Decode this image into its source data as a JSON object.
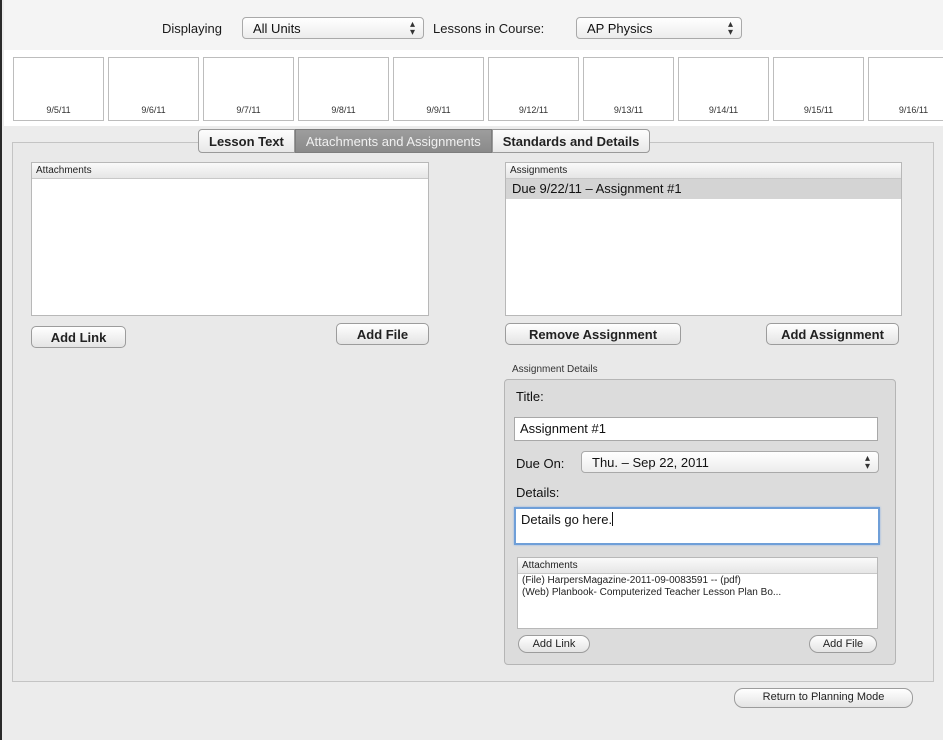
{
  "toolbar": {
    "displaying_label": "Displaying",
    "displaying_value": "All Units",
    "course_label": "Lessons in Course:",
    "course_value": "AP Physics"
  },
  "dates": [
    "9/5/11",
    "9/6/11",
    "9/7/11",
    "9/8/11",
    "9/9/11",
    "9/12/11",
    "9/13/11",
    "9/14/11",
    "9/15/11",
    "9/16/11"
  ],
  "tabs": [
    {
      "label": "Lesson Text",
      "active": false
    },
    {
      "label": "Attachments and Assignments",
      "active": true
    },
    {
      "label": "Standards and Details",
      "active": false
    }
  ],
  "attachments": {
    "header": "Attachments",
    "add_link": "Add Link",
    "add_file": "Add File"
  },
  "assignments": {
    "header": "Assignments",
    "items": [
      "Due 9/22/11 – Assignment #1"
    ],
    "remove_button": "Remove Assignment",
    "add_button": "Add Assignment"
  },
  "assignment_details": {
    "group_label": "Assignment Details",
    "title_label": "Title:",
    "title_value": "Assignment #1",
    "due_label": "Due On:",
    "due_value": "Thu. – Sep 22, 2011",
    "details_label": "Details:",
    "details_value": "Details go here.",
    "attachments_header": "Attachments",
    "attachment_items": [
      "(File) HarpersMagazine-2011-09-0083591 -- (pdf)",
      "(Web) Planbook- Computerized Teacher Lesson Plan Bo..."
    ],
    "add_link": "Add Link",
    "add_file": "Add File"
  },
  "footer": {
    "return_button": "Return to Planning Mode"
  }
}
